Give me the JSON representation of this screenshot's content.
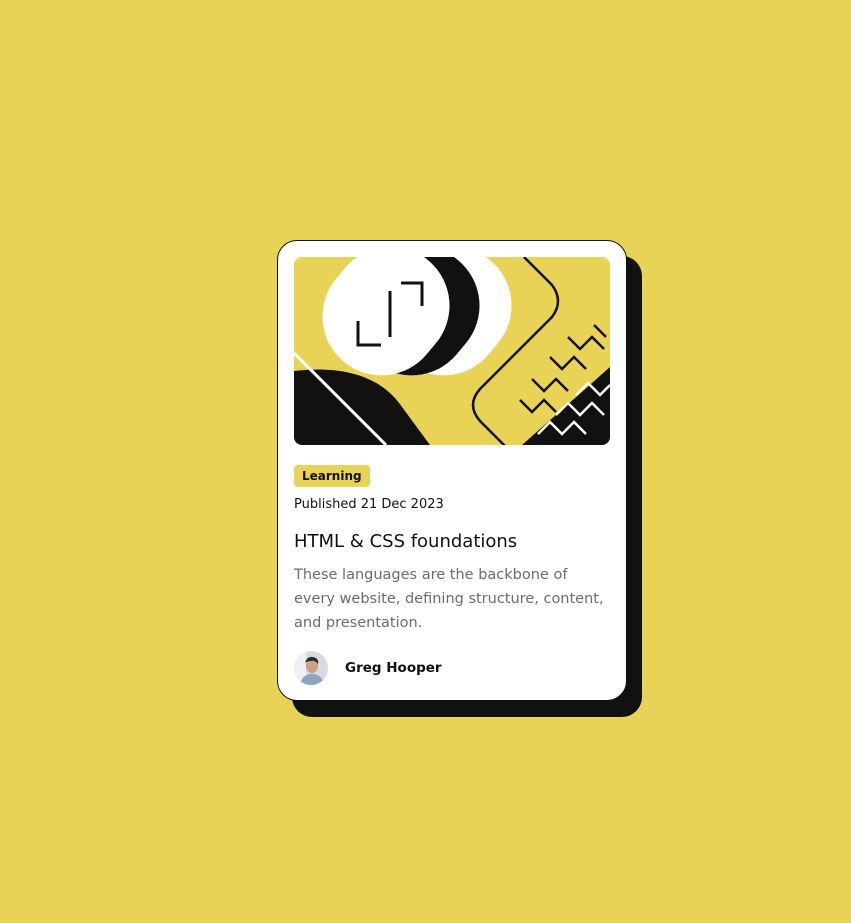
{
  "colors": {
    "background": "#e9d357",
    "card": "#ffffff",
    "ink": "#111111",
    "muted_text": "#6b6b6b"
  },
  "card": {
    "hero_image": "abstract-illustration",
    "category": "Learning",
    "published": "Published 21 Dec 2023",
    "title": "HTML & CSS foundations",
    "description": "These languages are the backbone of every website, defining structure, content, and presentation.",
    "author": {
      "avatar": "avatar-icon",
      "name": "Greg Hooper"
    }
  }
}
